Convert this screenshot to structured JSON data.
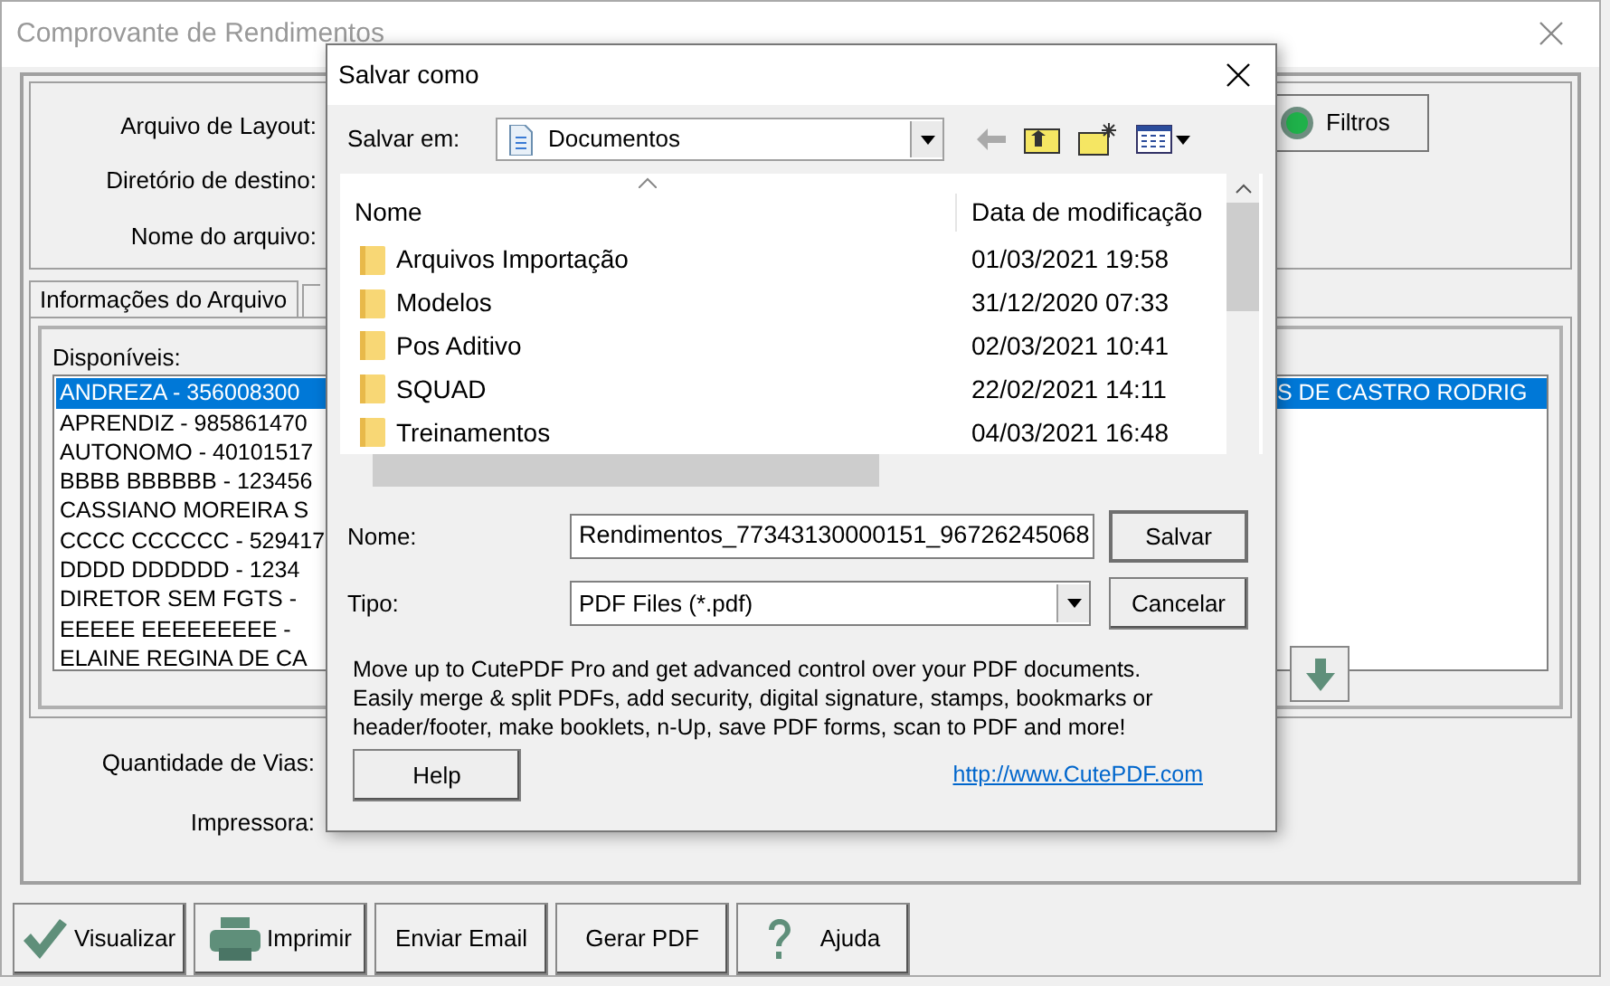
{
  "window": {
    "title": "Comprovante de Rendimentos"
  },
  "form": {
    "labels": [
      "Arquivo de Layout:",
      "Diretório de destino:",
      "Nome do arquivo:"
    ],
    "filter_button": "Filtros"
  },
  "tabs": [
    {
      "label": "Informações do Arquivo",
      "selected": true
    }
  ],
  "available": {
    "label": "Disponíveis:",
    "items": [
      {
        "text": "ANDREZA - 356008300",
        "selected": true
      },
      {
        "text": "APRENDIZ - 985861470",
        "selected": false
      },
      {
        "text": "AUTONOMO - 40101517",
        "selected": false
      },
      {
        "text": "BBBB BBBBBB - 123456",
        "selected": false
      },
      {
        "text": "CASSIANO MOREIRA S",
        "selected": false
      },
      {
        "text": "CCCC CCCCCC - 529417",
        "selected": false
      },
      {
        "text": "DDDD DDDDDD - 1234",
        "selected": false
      },
      {
        "text": "DIRETOR SEM FGTS -",
        "selected": false
      },
      {
        "text": "EEEEE EEEEEEEEE -",
        "selected": false
      },
      {
        "text": "ELAINE REGINA DE CA",
        "selected": false
      }
    ]
  },
  "chosen": {
    "items": [
      {
        "text": "S DE CASTRO RODRIG",
        "selected": true
      }
    ]
  },
  "lower_labels": [
    "Quantidade de Vias:",
    "Impressora:"
  ],
  "buttons": [
    "Visualizar",
    "Imprimir",
    "Enviar Email",
    "Gerar PDF",
    "Ajuda"
  ],
  "dialog": {
    "title": "Salvar como",
    "save_in_label": "Salvar em:",
    "save_in_value": "Documentos",
    "columns": [
      "Nome",
      "Data de modificação"
    ],
    "files": [
      {
        "name": "Arquivos Importação",
        "date": "01/03/2021 19:58"
      },
      {
        "name": "Modelos",
        "date": "31/12/2020 07:33"
      },
      {
        "name": "Pos Aditivo",
        "date": "02/03/2021 10:41"
      },
      {
        "name": "SQUAD",
        "date": "22/02/2021 14:11"
      },
      {
        "name": "Treinamentos",
        "date": "04/03/2021 16:48"
      }
    ],
    "name_label": "Nome:",
    "name_value": "Rendimentos_77343130000151_96726245068",
    "type_label": "Tipo:",
    "type_value": "PDF Files (*.pdf)",
    "save_button": "Salvar",
    "cancel_button": "Cancelar",
    "promo": "Move up to CutePDF Pro and get advanced control over your PDF documents. Easily merge & split PDFs, add security, digital signature, stamps, bookmarks or header/footer, make booklets, n-Up, save PDF forms, scan to PDF and more!",
    "help_button": "Help",
    "link": "http://www.CutePDF.com"
  }
}
